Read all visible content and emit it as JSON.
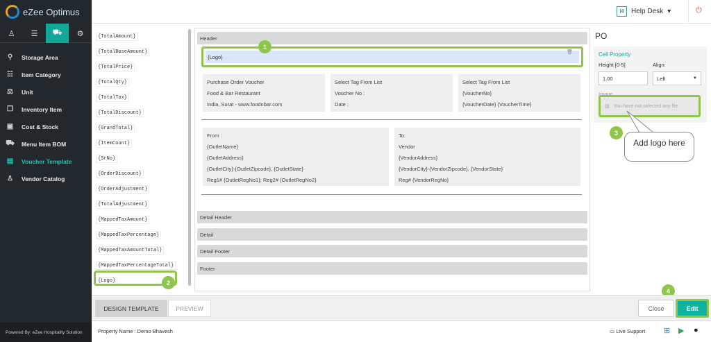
{
  "app": {
    "name": "eZee Optimus",
    "powered_by": "Powered By: eZee Hospitality Solution"
  },
  "sidebar": {
    "icon_tabs": [
      {
        "icon": "user-icon",
        "glyph": "♙"
      },
      {
        "icon": "menu-icon",
        "glyph": "☰"
      },
      {
        "icon": "cart-icon",
        "glyph": "⛟"
      },
      {
        "icon": "gear-icon",
        "glyph": "⚙"
      }
    ],
    "items": [
      {
        "label": "Storage Area",
        "icon": "location-pin-icon",
        "glyph": "⚲"
      },
      {
        "label": "Item Category",
        "icon": "list-icon",
        "glyph": "☷"
      },
      {
        "label": "Unit",
        "icon": "scale-icon",
        "glyph": "⚖"
      },
      {
        "label": "Inventory Item",
        "icon": "box-icon",
        "glyph": "❒"
      },
      {
        "label": "Cost & Stock",
        "icon": "money-icon",
        "glyph": "▣"
      },
      {
        "label": "Menu Item BOM",
        "icon": "cart-icon",
        "glyph": "⛟"
      },
      {
        "label": "Voucher Template",
        "icon": "template-icon",
        "glyph": "▤"
      },
      {
        "label": "Vendor Catalog",
        "icon": "person-icon",
        "glyph": "♙"
      }
    ]
  },
  "topbar": {
    "help_badge": "H",
    "help_desk": "Help Desk",
    "caret": "▾",
    "power_glyph": "⏻"
  },
  "tags": [
    "{TotalAmount}",
    "{TotalBaseAmount}",
    "{TotalPrice}",
    "{TotalQty}",
    "{TotalTax}",
    "{TotalDiscount}",
    "{GrandTotal}",
    "{ItemCount}",
    "{SrNo}",
    "{OrderDiscount}",
    "{OrderAdjustment}",
    "{TotalAdjustment}",
    "{MappedTaxAmount}",
    "{MappedTaxPercentage}",
    "{MappedTaxAmountTotal}",
    "{MappedTaxPercentageTotal}",
    "{Logo}"
  ],
  "design": {
    "header_label": "Header",
    "logo_cell": "{Logo}",
    "box1": {
      "l1": "Purchase Order Voucher",
      "l2": "Food & Bar Restaurant",
      "l3": "India, Surat - www.foodnbar.com"
    },
    "box2": {
      "l1": "Select Tag From List",
      "l2": "Voucher No :",
      "l3": "Date :"
    },
    "box3": {
      "l1": "Select Tag From List",
      "l2": "{VoucherNo}",
      "l3": "{VoucherDate} {VoucherTime}"
    },
    "from": {
      "l1": "From :",
      "l2": "{OutletName}",
      "l3": "{OutletAddress}",
      "l4": "{OutletCity}-{OutletZipcode}, {OutletState}",
      "l5": "Reg1# {OutletRegNo1}; Reg2# {OutletRegNo2}"
    },
    "to": {
      "l1": "To:",
      "l2": "Vendor",
      "l3": "{VendorAddress}",
      "l4": "{VendorCity}-{VendorZipcode}, {VendorState}",
      "l5": "Reg# {VendorRegNo}"
    },
    "sections": [
      "Detail Header",
      "Detail",
      "Detail Footer",
      "Footer"
    ]
  },
  "panel": {
    "title": "PO",
    "cell_property": "Cell Property",
    "height_label": "Height [0-5]",
    "height_value": "1.00",
    "align_label": "Align:",
    "align_value": "Left",
    "image_label": "Image",
    "image_placeholder": "You have not selected any file"
  },
  "callout": {
    "text": "Add logo here"
  },
  "markers": [
    "1",
    "2",
    "3",
    "4"
  ],
  "bottom": {
    "tab_design": "DESIGN TEMPLATE",
    "tab_preview": "PREVIEW",
    "close": "Close",
    "edit": "Edit"
  },
  "footer": {
    "property": "Property Name : Demo Bhavesh",
    "live_support": "Live Support"
  },
  "colors": {
    "accent": "#11b2a0",
    "highlight": "#8dc64b",
    "sidebar": "#23282d"
  }
}
